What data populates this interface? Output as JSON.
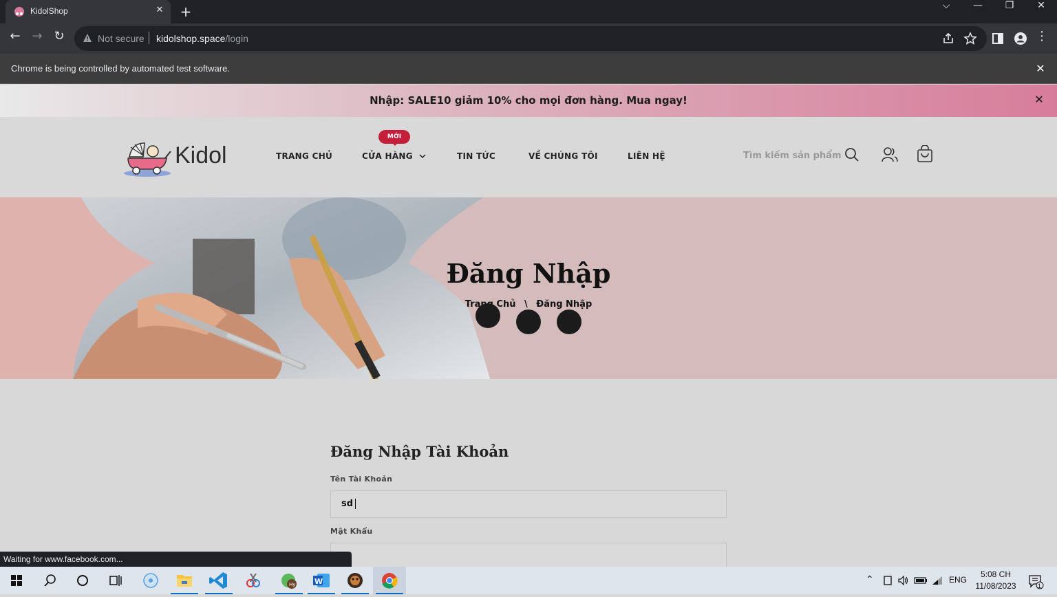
{
  "browser": {
    "tab_title": "KidolShop",
    "new_tab_label": "+",
    "url_warning": "Not secure",
    "url_domain": "kidolshop.space",
    "url_path": "/login",
    "infobar_text": "Chrome is being controlled by automated test software.",
    "status_text": "Waiting for www.facebook.com..."
  },
  "promo": {
    "text": "Nhập: SALE10 giảm 10% cho mọi đơn hàng. Mua ngay!"
  },
  "header": {
    "logo_text": "Kidol",
    "nav": [
      {
        "label": "TRANG CHỦ"
      },
      {
        "label": "CỬA HÀNG"
      },
      {
        "label": "TIN TỨC"
      },
      {
        "label": "VỀ CHÚNG TÔI"
      },
      {
        "label": "LIÊN HỆ"
      }
    ],
    "new_badge": "MỚI",
    "search_placeholder": "Tìm kiếm sản phẩm"
  },
  "hero": {
    "title": "Đăng Nhập",
    "breadcrumb_home": "Trang Chủ",
    "breadcrumb_sep": "\\",
    "breadcrumb_current": "Đăng Nhập"
  },
  "form": {
    "title": "Đăng Nhập Tài Khoản",
    "username_label": "Tên Tài Khoản",
    "username_value": "sd",
    "password_label": "Mật Khẩu",
    "password_value": ""
  },
  "taskbar": {
    "language": "ENG",
    "time": "5:08 CH",
    "date": "11/08/2023",
    "notification_count": "1"
  },
  "colors": {
    "promo_gradient_end": "#d77d9b",
    "badge": "#c41e3a",
    "hero_bg": "#d4bbbc"
  }
}
